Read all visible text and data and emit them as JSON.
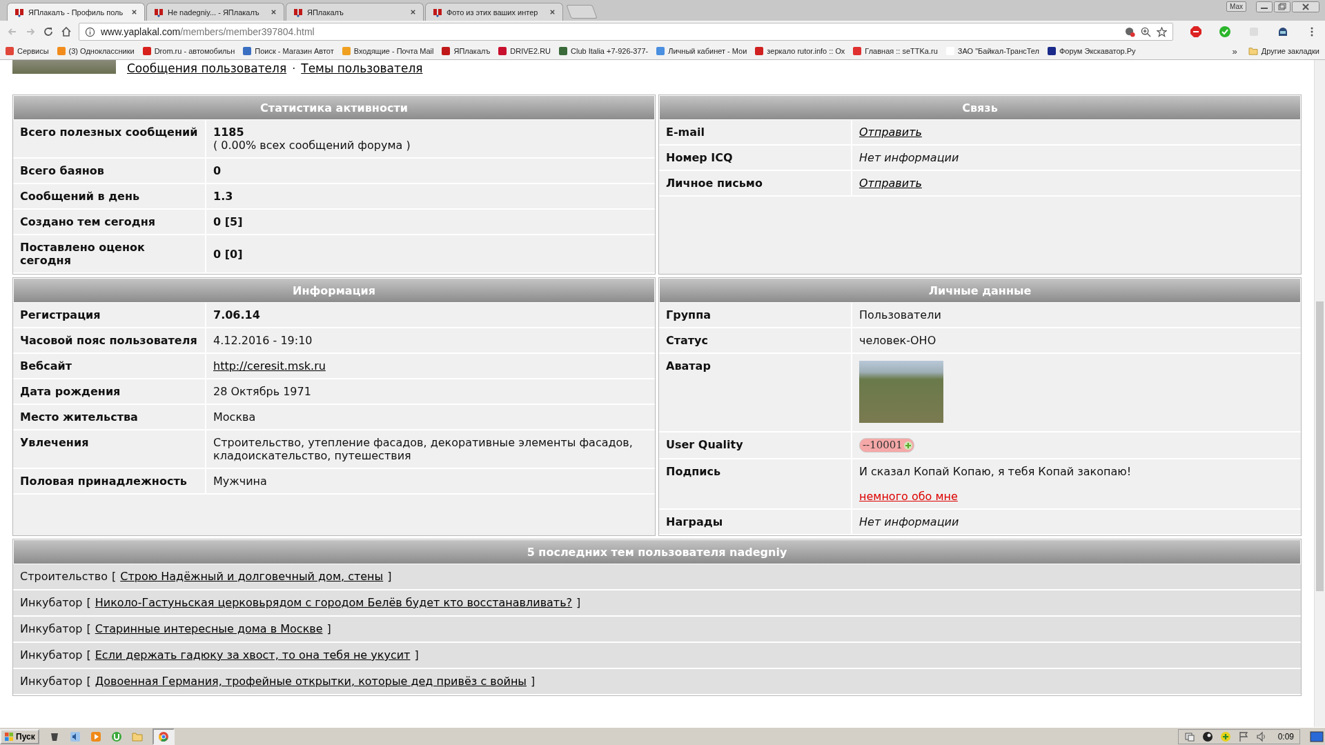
{
  "window": {
    "tabs": [
      {
        "title": "ЯПлакалъ - Профиль поль",
        "selected": true
      },
      {
        "title": "Не nadegniy... - ЯПлакалъ",
        "selected": false
      },
      {
        "title": "ЯПлакалъ",
        "selected": false
      },
      {
        "title": "Фото из этих ваших интер",
        "selected": false
      }
    ],
    "user_button": "Max"
  },
  "address": {
    "host": "www.yaplakal.com",
    "path": "/members/member397804.html"
  },
  "bookmarks": {
    "items": [
      {
        "label": "Сервисы",
        "color": "#e0463a"
      },
      {
        "label": "(3) Одноклассники",
        "color": "#f28c1c"
      },
      {
        "label": "Drom.ru - автомобильн",
        "color": "#d8201c"
      },
      {
        "label": "Поиск - Магазин Автот",
        "color": "#3a6fc2"
      },
      {
        "label": "Входящие - Почта Mail",
        "color": "#f0a020"
      },
      {
        "label": "ЯПлакалъ",
        "color": "#c01818"
      },
      {
        "label": "DRIVE2.RU",
        "color": "#c8102e"
      },
      {
        "label": "Club Italia +7-926-377-",
        "color": "#3a6a3a"
      },
      {
        "label": "Личный кабинет - Мои",
        "color": "#4a8fe0"
      },
      {
        "label": "зеркало rutor.info :: Ох",
        "color": "#d02020"
      },
      {
        "label": "Главная :: seTTKa.ru",
        "color": "#e03030"
      },
      {
        "label": "ЗАО \"Байкал-ТрансТел",
        "color": "#ffffff"
      },
      {
        "label": "Форум Экскаватор.Ру",
        "color": "#1a2a8a"
      }
    ],
    "overflow": "»",
    "other": "Другие закладки"
  },
  "profile_links": {
    "messages": "Сообщения пользователя",
    "separator": "·",
    "topics": "Темы пользователя"
  },
  "panels": [
    {
      "title": "Статистика активности",
      "rows": [
        {
          "label": "Всего полезных сообщений",
          "kind": "bold",
          "value": "1185",
          "note": "( 0.00% всех сообщений форума )"
        },
        {
          "label": "Всего баянов",
          "kind": "bold",
          "value": "0"
        },
        {
          "label": "Сообщений в день",
          "kind": "bold",
          "value": "1.3"
        },
        {
          "label": "Создано тем сегодня",
          "kind": "bold",
          "value": "0 [5]"
        },
        {
          "label": "Поставлено оценок сегодня",
          "kind": "bold",
          "value": "0 [0]"
        }
      ]
    },
    {
      "title": "Связь",
      "rows": [
        {
          "label": "E-mail",
          "kind": "italic_link",
          "value": "Отправить"
        },
        {
          "label": "Номер ICQ",
          "kind": "italic",
          "value": "Нет информации"
        },
        {
          "label": "Личное письмо",
          "kind": "italic_link",
          "value": "Отправить"
        }
      ]
    },
    {
      "title": "Информация",
      "rows": [
        {
          "label": "Регистрация",
          "kind": "bold",
          "value": "7.06.14"
        },
        {
          "label": "Часовой пояс пользователя",
          "kind": "plain",
          "value": "4.12.2016 - 19:10"
        },
        {
          "label": "Вебсайт",
          "kind": "link",
          "value": "http://ceresit.msk.ru"
        },
        {
          "label": "Дата рождения",
          "kind": "plain",
          "value": "28 Октябрь 1971"
        },
        {
          "label": "Место жительства",
          "kind": "plain",
          "value": "Москва"
        },
        {
          "label": "Увлечения",
          "kind": "plain",
          "value": "Строительство, утепление фасадов, декоративные элементы фасадов, кладоискательство, путешествия"
        },
        {
          "label": "Половая принадлежность",
          "kind": "plain",
          "value": "Мужчина"
        }
      ]
    },
    {
      "title": "Личные данные",
      "rows": [
        {
          "label": "Группа",
          "kind": "plain",
          "value": "Пользователи"
        },
        {
          "label": "Статус",
          "kind": "plain",
          "value": "человек-ОНО"
        },
        {
          "label": "Аватар",
          "kind": "avatar"
        },
        {
          "label": "User Quality",
          "kind": "quality",
          "value": "--10001"
        },
        {
          "label": "Подпись",
          "kind": "signature",
          "value": "И сказал Копай Копаю, я тебя Копай закопаю!",
          "link": "немного обо мне"
        },
        {
          "label": "Награды",
          "kind": "italic",
          "value": "Нет информации"
        }
      ]
    }
  ],
  "topics": {
    "title": "5 последних тем пользователя nadegniy",
    "items": [
      {
        "forum": "Строительство",
        "open": "[",
        "title": "Строю Надёжный и долговечный дом, стены",
        "close": "]"
      },
      {
        "forum": "Инкубатор",
        "open": "[",
        "title": "Николо-Гастуньская церковьрядом с городом Белёв будет кто восстанавливать?",
        "close": "]"
      },
      {
        "forum": "Инкубатор",
        "open": "[",
        "title": "Старинные интересные дома в Москве",
        "close": "]"
      },
      {
        "forum": "Инкубатор",
        "open": "[",
        "title": "Если держать гадюку за хвост, то она тебя не укусит",
        "close": "]"
      },
      {
        "forum": "Инкубатор",
        "open": "[",
        "title": "Довоенная Германия, трофейные открытки, которые дед привёз с войны",
        "close": "]"
      }
    ]
  },
  "taskbar": {
    "start": "Пуск",
    "clock": "0:09"
  }
}
